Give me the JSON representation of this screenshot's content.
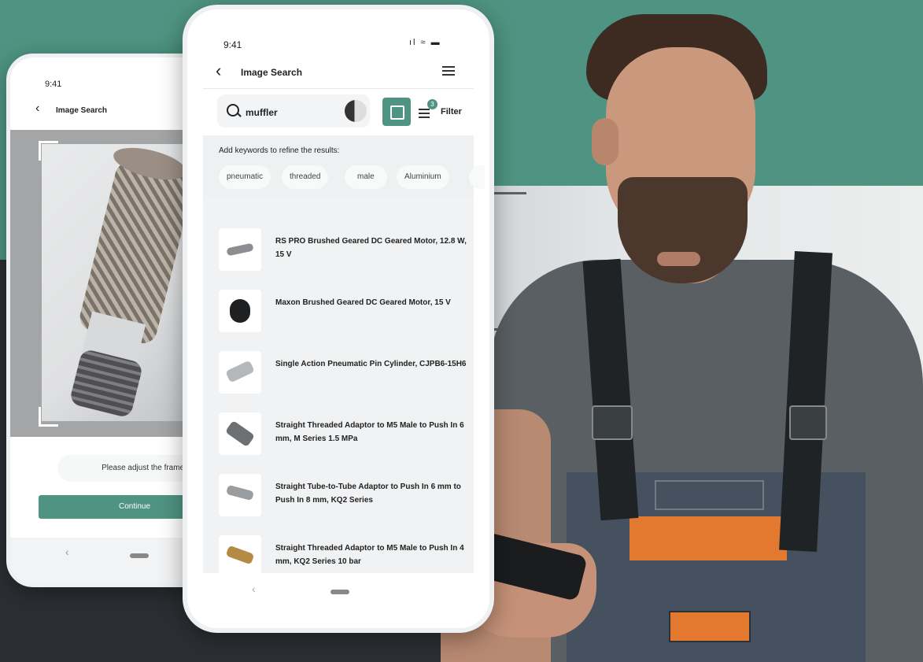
{
  "colors": {
    "brand_green": "#4f9482",
    "dark_bg": "#2b2f33"
  },
  "back_phone": {
    "status_time": "9:41",
    "header_title": "Image Search",
    "adjust_hint": "Please adjust the frame.",
    "continue_label": "Continue",
    "nav_back_glyph": "‹"
  },
  "front_phone": {
    "status_time": "9:41",
    "status_icons": "ıl ≈ ▬",
    "header_title": "Image Search",
    "search_query": "muffler",
    "filter_label": "Filter",
    "filter_count": "3",
    "refine_prompt": "Add keywords to refine the results:",
    "chips": [
      "pneumatic",
      "threaded",
      "male",
      "Aluminium"
    ],
    "results": [
      {
        "title": "RS PRO Brushed Geared DC Geared Motor, 12.8 W, 15 V"
      },
      {
        "title": "Maxon Brushed Geared DC Geared Motor, 15 V"
      },
      {
        "title": "Single Action Pneumatic Pin Cylinder, CJPB6-15H6"
      },
      {
        "title": "Straight Threaded Adaptor to M5 Male to Push In 6 mm, M Series 1.5 MPa"
      },
      {
        "title": "Straight Tube-to-Tube Adaptor to Push In 6 mm to Push In 8 mm, KQ2 Series"
      },
      {
        "title": "Straight Threaded Adaptor to M5 Male to Push In 4 mm, KQ2 Series 10 bar"
      }
    ],
    "nav_back_glyph": "‹"
  }
}
